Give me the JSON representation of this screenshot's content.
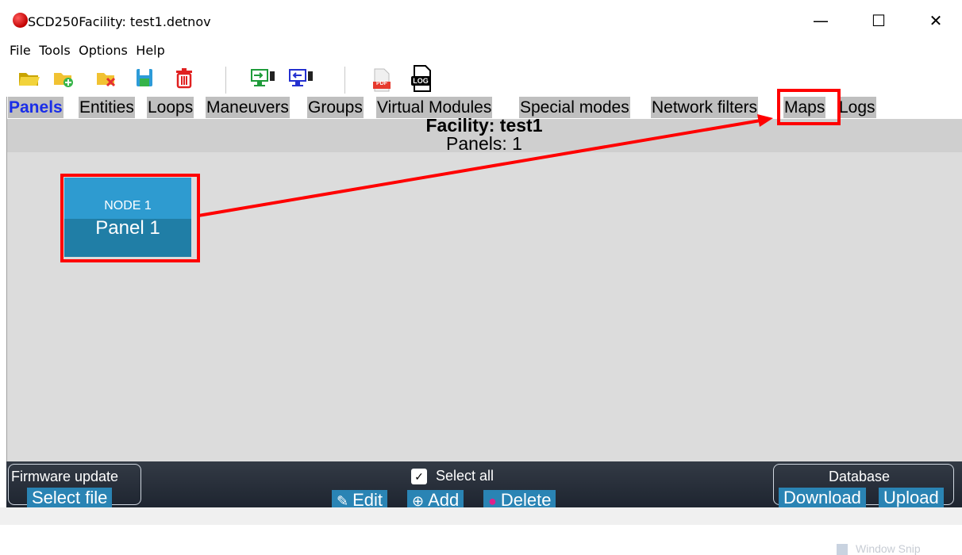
{
  "window": {
    "title": "SCD250Facility: test1.detnov",
    "minimize": "—",
    "maximize": "☐",
    "close": "✕"
  },
  "menu": [
    "File",
    "Tools",
    "Options",
    "Help"
  ],
  "toolbar": {
    "icons": [
      "open-folder-icon",
      "new-folder-icon",
      "delete-folder-icon",
      "save-icon",
      "trash-icon",
      "monitor-import-icon",
      "monitor-export-icon",
      "pdf-icon",
      "log-icon"
    ],
    "pdf_text": "PDF",
    "log_text": "LOG"
  },
  "tabs": [
    "Panels",
    "Entities",
    "Loops",
    "Maneuvers",
    "Groups",
    "Virtual Modules",
    "Special modes",
    "Network filters",
    "Maps",
    "Logs"
  ],
  "active_tab": "Panels",
  "header": {
    "facility": "Facility: test1",
    "panels": "Panels: 1"
  },
  "panel_card": {
    "node": "NODE 1",
    "name": "Panel 1"
  },
  "watermark": "Window Snip",
  "footer": {
    "firmware_title": "Firmware update",
    "select_file": "Select file",
    "select_all": "Select all",
    "edit": "Edit",
    "add": "Add",
    "delete": "Delete",
    "database_title": "Database",
    "download": "Download",
    "upload": "Upload"
  },
  "colors": {
    "highlight": "#ff0000",
    "active_tab": "#1a2ee8",
    "panel_card": "#207ea6",
    "footer_button": "#2a84b4"
  }
}
